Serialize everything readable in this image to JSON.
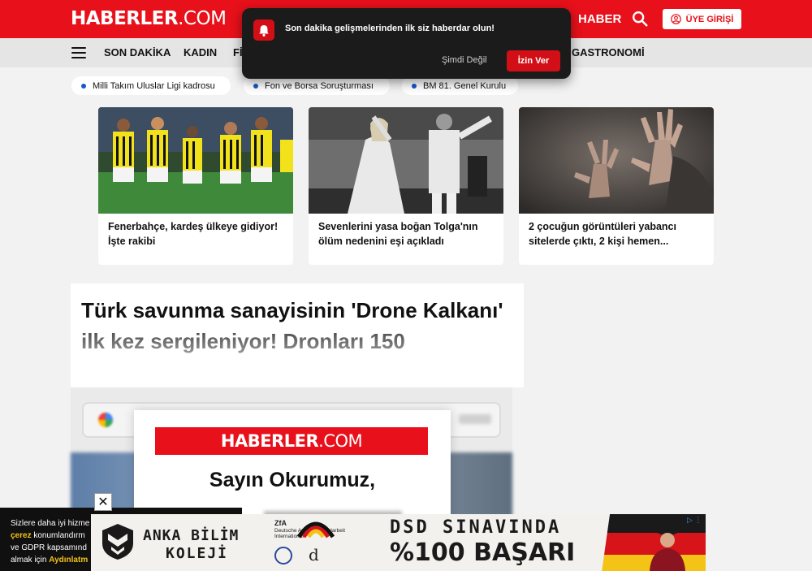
{
  "header": {
    "logo_main": "HABERLER",
    "logo_suffix": ".COM",
    "haber_label": "HABER",
    "login_label": "ÜYE GİRİŞİ"
  },
  "nav": {
    "items": [
      "SON DAKİKA",
      "KADIN",
      "Fİ",
      "GASTRONOMİ"
    ]
  },
  "notification": {
    "message": "Son dakika gelişmelerinden ilk siz haberdar olun!",
    "deny": "Şimdi Değil",
    "allow": "İzin Ver"
  },
  "topics": [
    "Milli Takım Uluslar Ligi kadrosu",
    "Fon ve Borsa Soruşturması",
    "BM 81. Genel Kurulu"
  ],
  "cards": [
    {
      "title": "Fenerbahçe, kardeş ülkeye gidiyor! İşte rakibi"
    },
    {
      "title": "Sevenlerini yasa boğan Tolga'nın ölüm nedenini eşi açıkladı"
    },
    {
      "title": "2 çocuğun görüntüleri yabancı sitelerde çıktı, 2 kişi hemen..."
    }
  ],
  "article": {
    "headline": "Türk savunma sanayisinin 'Drone Kalkanı' ilk kez sergileniyor! Dronları 150"
  },
  "modal": {
    "logo_main": "HABERLER",
    "logo_suffix": ".COM",
    "greeting": "Sayın Okurumuz,"
  },
  "cookie": {
    "line1": "Sizlere daha iyi hizme",
    "line2_highlight": "çerez",
    "line2_rest": " konumlandırm",
    "line3": "ve GDPR kapsamınd",
    "line4_prefix": "almak için ",
    "line4_highlight": "Aydınlatm"
  },
  "ad": {
    "brand_line1": "ANKA BİLİM",
    "brand_line2": "KOLEJİ",
    "partner_name": "ZfA",
    "partner_line1": "Deutsche Auslandsschularbeit",
    "partner_line2": "International",
    "partner_mark": "d",
    "headline_line1": "DSD SINAVINDA",
    "headline_line2": "%100 BAŞARI",
    "close_symbol": "✕",
    "info_label": "▷ ⋮"
  },
  "colors": {
    "brand_red": "#e8101a",
    "topic_dot": "#1a57c9",
    "cookie_highlight": "#f3c316"
  },
  "icons": [
    "search-icon",
    "user-icon",
    "bell-icon",
    "menu-icon",
    "close-icon",
    "google-icon"
  ]
}
